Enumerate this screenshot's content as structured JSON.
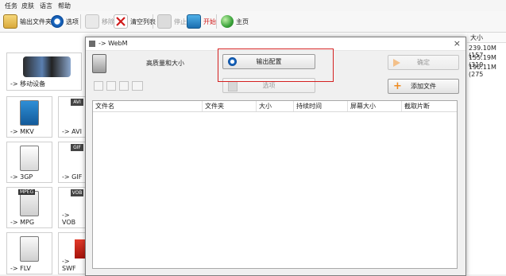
{
  "menu": [
    "任务",
    "皮肤",
    "语言",
    "帮助"
  ],
  "toolbar": {
    "output_folder": "输出文件夹",
    "options": "选项",
    "remove": "移除",
    "clear_list": "清空列表",
    "stop": "停止",
    "start": "开始",
    "home": "主页"
  },
  "left_panel": {
    "mobile": "-> 移动设备",
    "tiles": [
      {
        "label": "-> MKV",
        "badge": ""
      },
      {
        "label": "-> AVI",
        "badge": "AVI"
      },
      {
        "label": "-> 3GP",
        "badge": ""
      },
      {
        "label": "-> GIF",
        "badge": "GIF"
      },
      {
        "label": "-> MPG",
        "badge": "MPEG"
      },
      {
        "label": "-> VOB",
        "badge": "VOB"
      },
      {
        "label": "-> FLV",
        "badge": ""
      },
      {
        "label": "-> SWF",
        "badge": ""
      }
    ]
  },
  "background_list": {
    "size_header": "大小",
    "sizes": [
      "239.10M (157",
      "155.19M (319",
      "190.11M (275"
    ]
  },
  "dialog": {
    "title": "-> WebM",
    "quality_label": "高质量和大小",
    "output_config": "输出配置",
    "options_btn": "选项",
    "confirm": "确定",
    "add_file": "添加文件",
    "columns": [
      "文件名",
      "文件夹",
      "大小",
      "持续时间",
      "屏幕大小",
      "截取片断"
    ],
    "close_glyph": "×"
  }
}
